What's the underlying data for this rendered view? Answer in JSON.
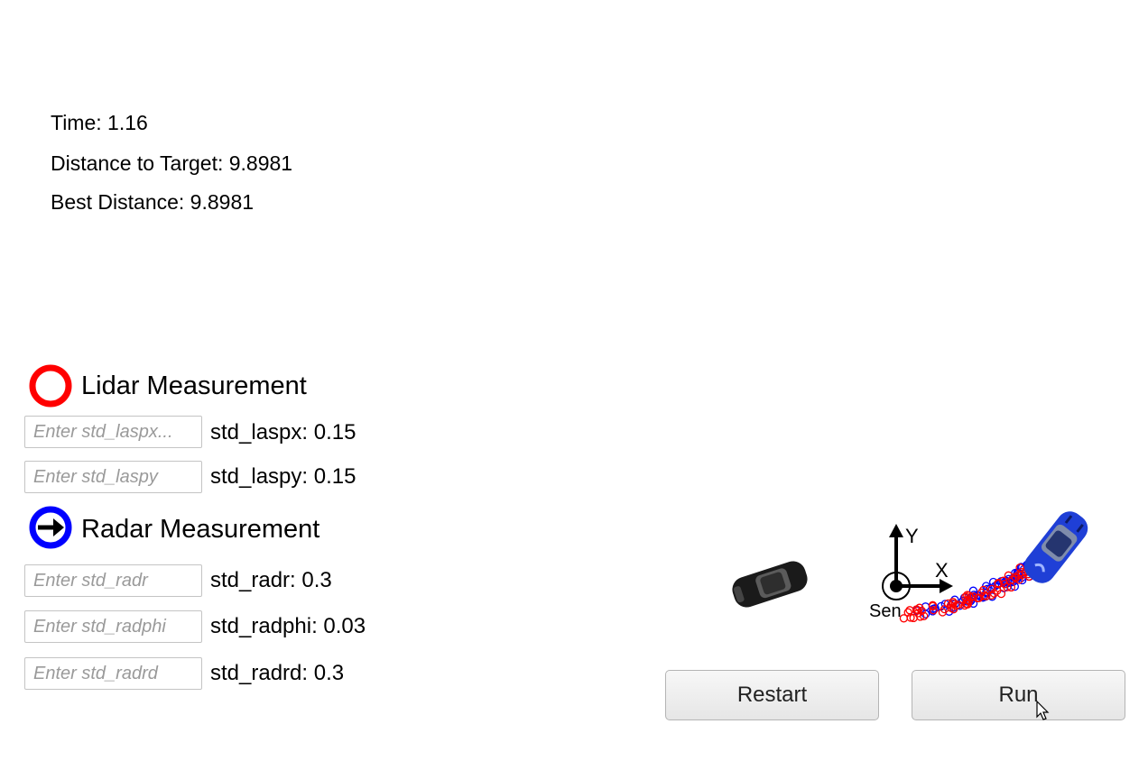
{
  "stats": {
    "time": "Time: 1.16",
    "distance": "Distance to Target: 9.8981",
    "best": "Best Distance: 9.8981"
  },
  "lidar": {
    "title": "Lidar Measurement",
    "icon": "red-ring-icon",
    "color": "#ff0000",
    "inputs": [
      {
        "placeholder": "Enter std_laspx...",
        "label": "std_laspx: 0.15"
      },
      {
        "placeholder": "Enter std_laspy",
        "label": "std_laspy: 0.15"
      }
    ]
  },
  "radar": {
    "title": "Radar Measurement",
    "icon": "blue-ring-arrow-icon",
    "color": "#0000ff",
    "inputs": [
      {
        "placeholder": "Enter std_radr",
        "label": "std_radr: 0.3"
      },
      {
        "placeholder": "Enter std_radphi",
        "label": "std_radphi: 0.03"
      },
      {
        "placeholder": "Enter std_radrd",
        "label": "std_radrd: 0.3"
      }
    ]
  },
  "scene": {
    "axis_y": "Y",
    "axis_x": "X",
    "sensor_label": "Sen",
    "lidar_color": "#ff0000",
    "radar_color": "#0000ff",
    "target_car_color": "#1a1a1a",
    "tracked_car_color": "#1f3fd6"
  },
  "buttons": {
    "restart": "Restart",
    "run": "Run"
  }
}
